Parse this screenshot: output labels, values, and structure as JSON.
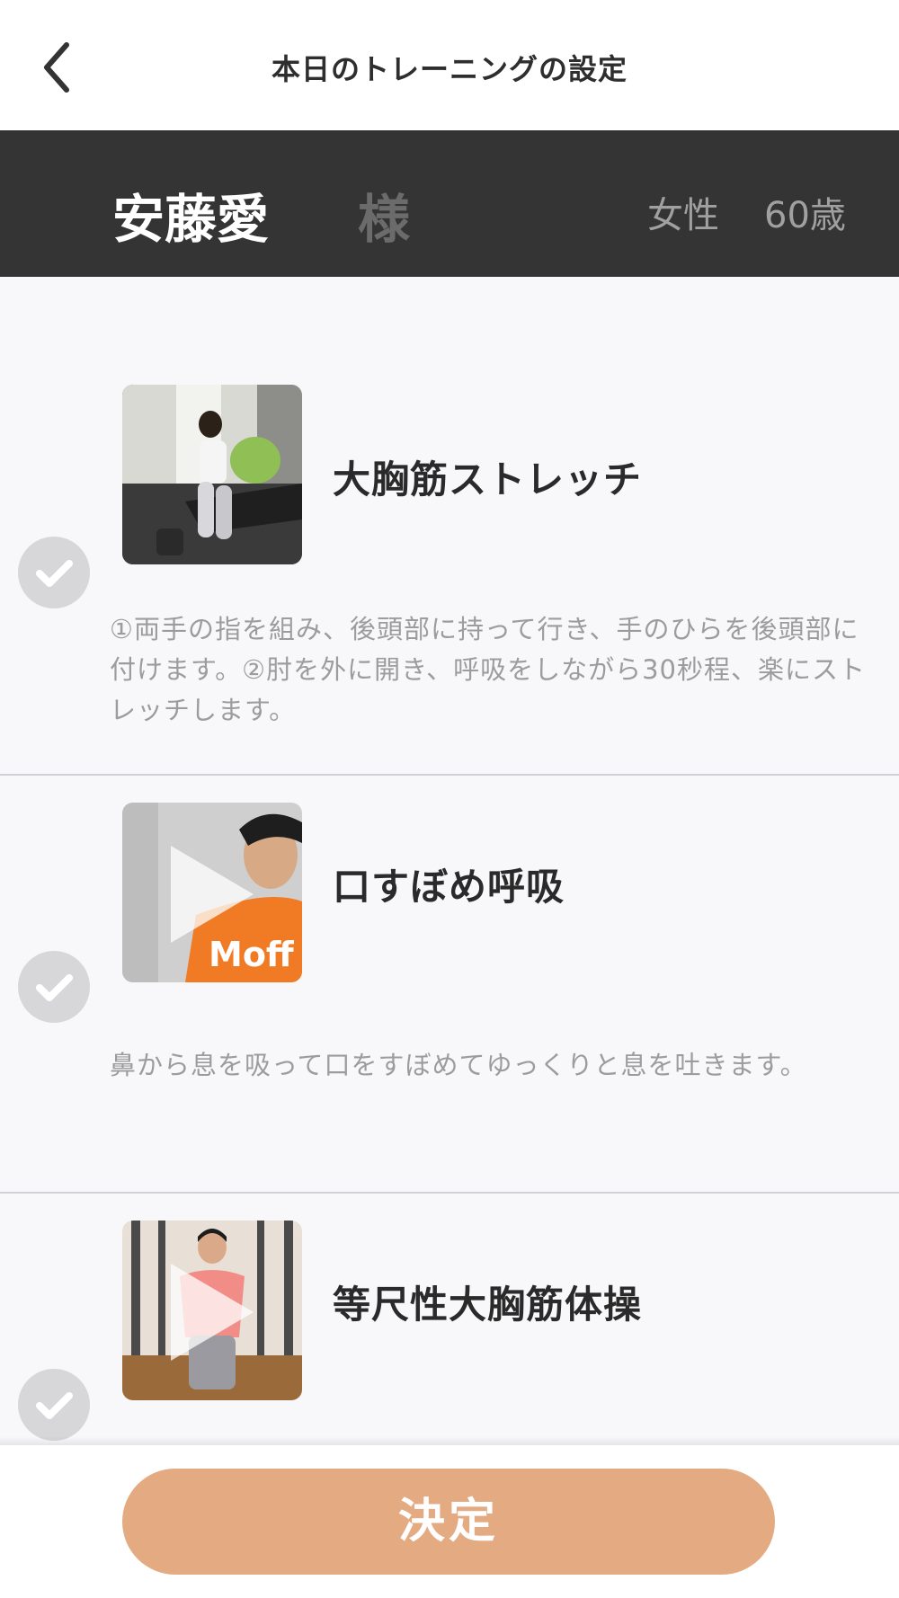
{
  "nav": {
    "title": "本日のトレーニングの設定",
    "back_icon": "chevron-left-icon"
  },
  "user": {
    "name": "安藤愛",
    "honorific": "様",
    "gender": "女性",
    "age": "60歳"
  },
  "exercises": [
    {
      "title": "大胸筋ストレッチ",
      "description": "①両手の指を組み、後頭部に持って行き、手のひらを後頭部に付けます。②肘を外に開き、呼吸をしながら30秒程、楽にストレッチします。",
      "checked": true,
      "thumbnail": "woman-stretching-on-bench"
    },
    {
      "title": "口すぼめ呼吸",
      "description": "鼻から息を吸って口をすぼめてゆっくりと息を吐きます。",
      "checked": true,
      "thumbnail": "man-in-orange-moff-shirt",
      "thumbnail_text": "Moff"
    },
    {
      "title": "等尺性大胸筋体操",
      "description": "",
      "checked": true,
      "thumbnail": "woman-seated-pressing-palms"
    }
  ],
  "footer": {
    "confirm_label": "決定"
  },
  "colors": {
    "accent": "#e4aa82",
    "header_bg": "#343434",
    "list_bg": "#f8f8fb",
    "check_bg": "#d7d7d9"
  }
}
